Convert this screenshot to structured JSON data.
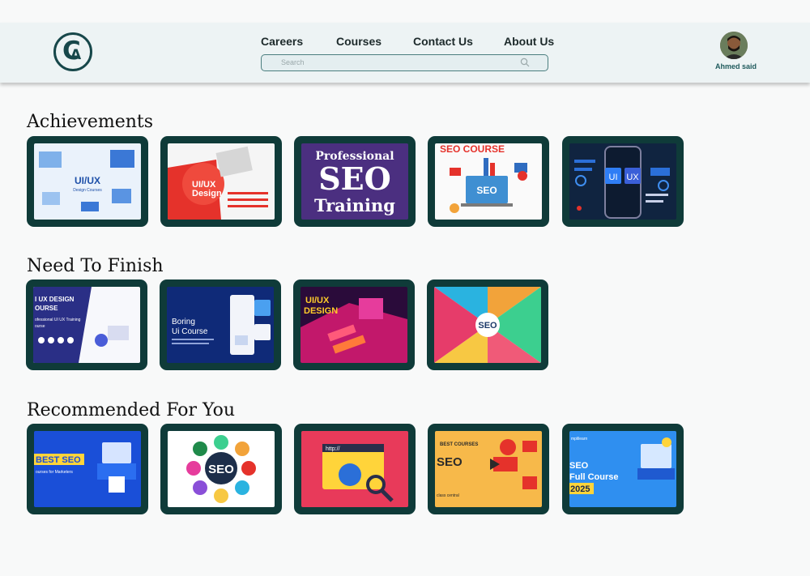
{
  "nav": [
    "Careers",
    "Courses",
    "Contact Us",
    "About Us"
  ],
  "search": {
    "placeholder": "Search"
  },
  "user": {
    "name": "Ahmed said"
  },
  "sections": {
    "achievements": {
      "title": "Achievements",
      "cards": [
        {
          "name": "ui-ux-design-courses",
          "lines": [
            "UI/UX",
            "Design Courses"
          ]
        },
        {
          "name": "ui-ux-design-journey",
          "lines": [
            "UI/UX",
            "Design"
          ]
        },
        {
          "name": "professional-seo-training",
          "lines": [
            "Professional",
            "SEO",
            "Training"
          ]
        },
        {
          "name": "seo-course",
          "lines": [
            "SEO COURSE",
            "SEO"
          ]
        },
        {
          "name": "ui-ux-phone",
          "lines": [
            "UI",
            "UX"
          ]
        }
      ]
    },
    "need_to_finish": {
      "title": "Need To Finish",
      "cards": [
        {
          "name": "ui-ux-design-course",
          "lines": [
            "I UX DESIGN",
            "OURSE",
            "ofessional UI UX Training",
            "ourse"
          ]
        },
        {
          "name": "boring-ui-course",
          "lines": [
            "Boring",
            "Ui Course"
          ]
        },
        {
          "name": "ui-ux-design-3d",
          "lines": [
            "UI/UX",
            "DESIGN"
          ]
        },
        {
          "name": "seo-infographic",
          "lines": [
            "SEO"
          ]
        }
      ]
    },
    "recommended": {
      "title": "Recommended For You",
      "cards": [
        {
          "name": "best-seo-courses",
          "lines": [
            "BEST SEO",
            "ourses for Marketers"
          ]
        },
        {
          "name": "seo-circle",
          "lines": [
            "SEO"
          ]
        },
        {
          "name": "seo-browser",
          "lines": [
            "http://"
          ]
        },
        {
          "name": "best-courses-seo",
          "lines": [
            "BEST COURSES",
            "SEO",
            "class central"
          ]
        },
        {
          "name": "seo-full-course-2025",
          "lines": [
            "mplilearn",
            "SEO",
            "Full Course",
            "2025"
          ]
        }
      ]
    }
  },
  "colors": {
    "card_frame": "#0f3b39",
    "brand": "#17474a",
    "header_bg": "#edf3f4"
  }
}
